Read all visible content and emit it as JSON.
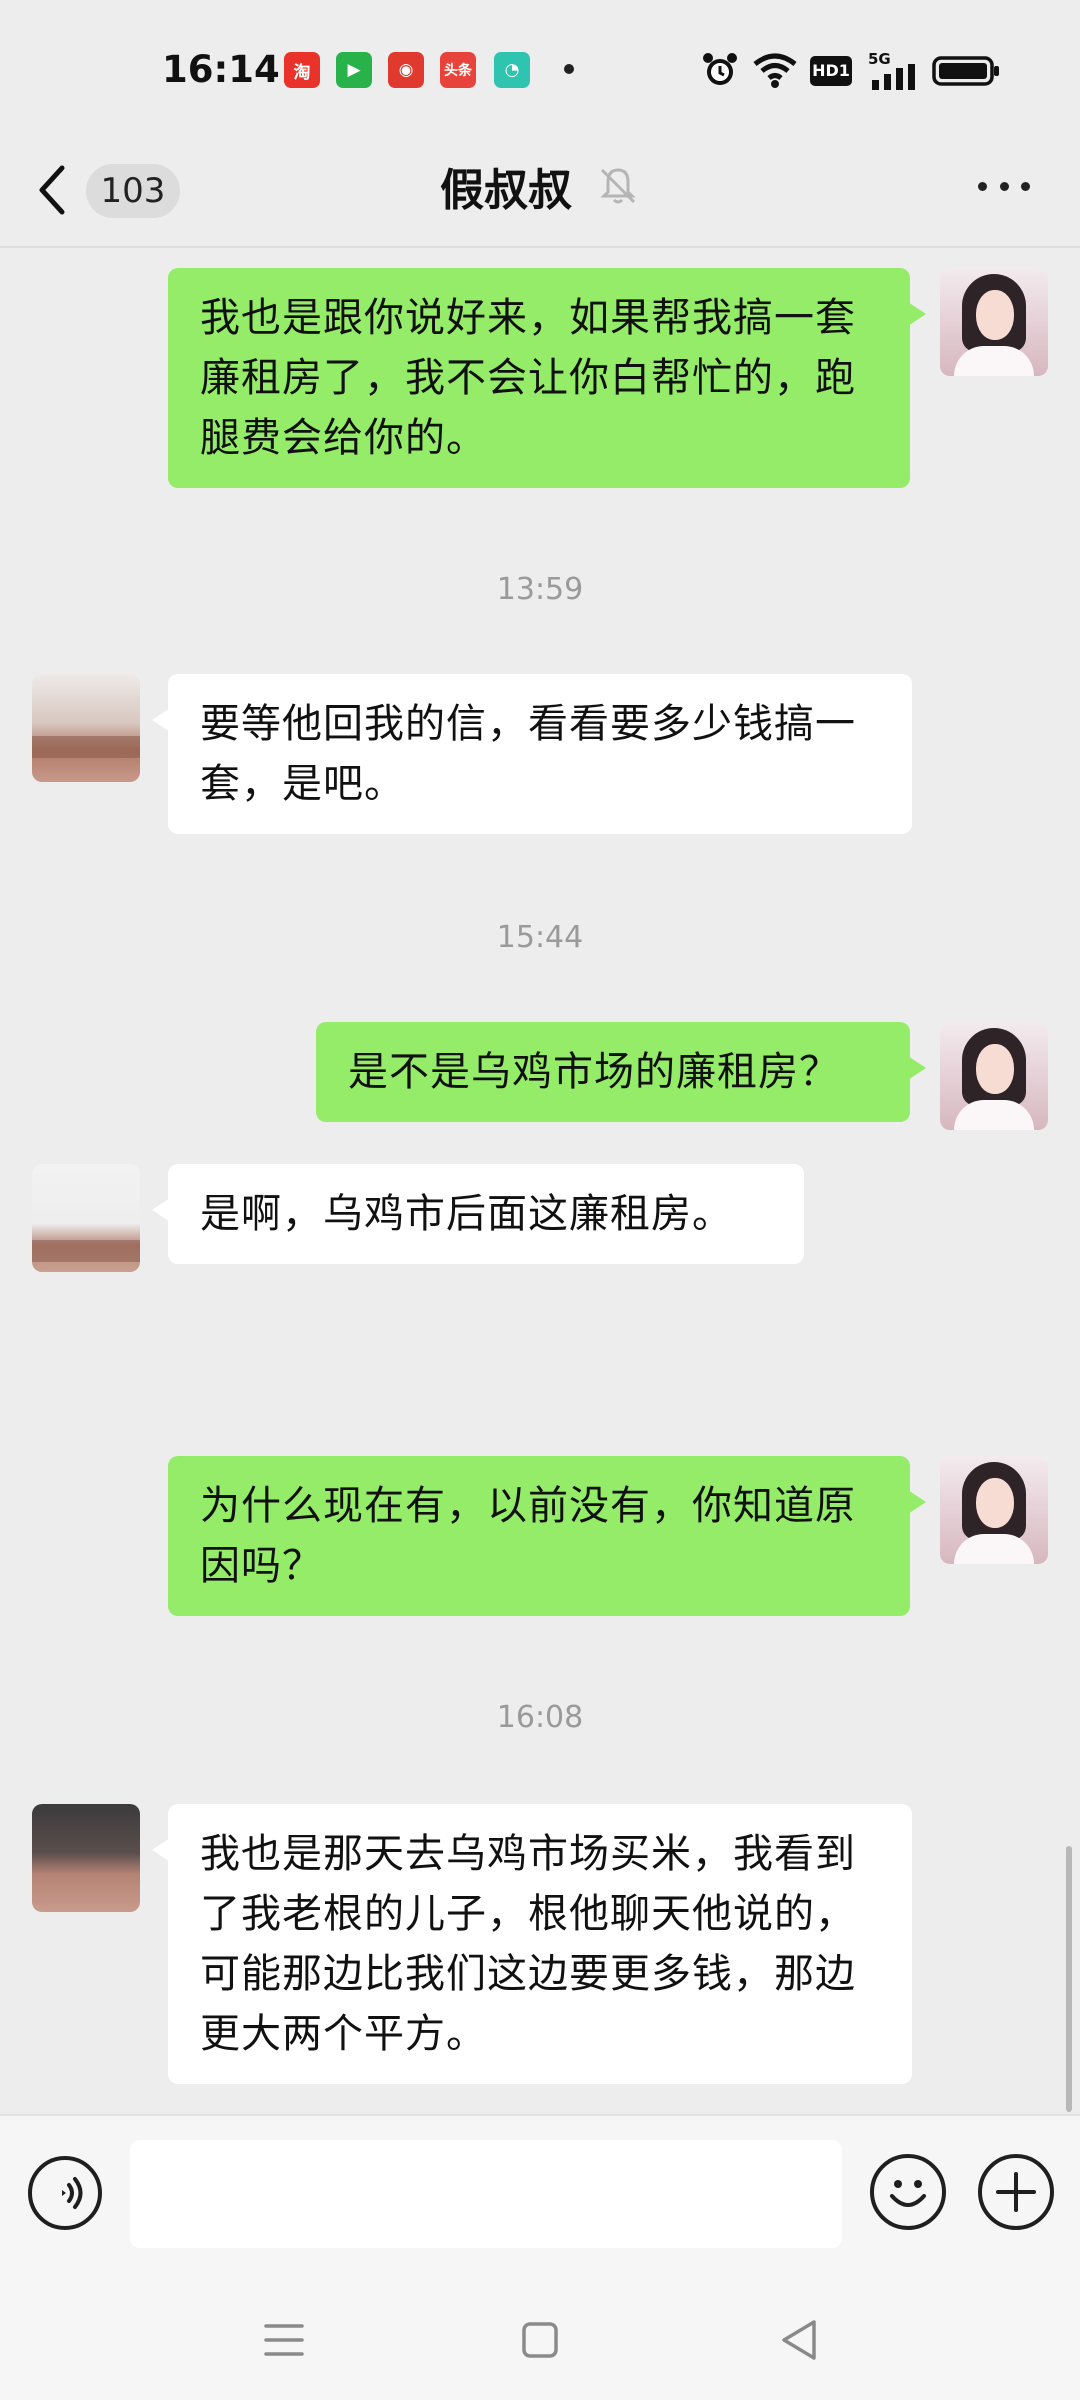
{
  "status_bar": {
    "time": "16:14",
    "apps": [
      {
        "icon": "taobao-app-icon",
        "label": "淘",
        "color": "#e8322a"
      },
      {
        "icon": "tencent-video-app-icon",
        "label": "▶",
        "color": "#27b24a"
      },
      {
        "icon": "news-app-icon",
        "label": "◉",
        "color": "#e03a2e"
      },
      {
        "icon": "toutiao-app-icon",
        "label": "头条",
        "color": "#e8433a"
      },
      {
        "icon": "chat-app-icon",
        "label": "◔",
        "color": "#2ec4b0"
      }
    ],
    "hd_label": "HD1",
    "network_label": "5G"
  },
  "header": {
    "unread_count": "103",
    "title": "假叔叔"
  },
  "messages": [
    {
      "side": "out",
      "text": "我也是跟你说好来，如果帮我搞一套廉租房了，我不会让你白帮忙的，跑腿费会给你的。"
    },
    {
      "type": "time",
      "text": "13:59"
    },
    {
      "side": "in",
      "text": "要等他回我的信，看看要多少钱搞一套，是吧。"
    },
    {
      "type": "time",
      "text": "15:44"
    },
    {
      "side": "out",
      "text": "是不是乌鸡市场的廉租房？"
    },
    {
      "side": "in",
      "text": "是啊，乌鸡市后面这廉租房。"
    },
    {
      "side": "out",
      "text": "为什么现在有，以前没有，你知道原因吗？"
    },
    {
      "type": "time",
      "text": "16:08"
    },
    {
      "side": "in",
      "text": "我也是那天去乌鸡市场买米，我看到了我老根的儿子，根他聊天他说的，可能那边比我们这边要更多钱，那边更大两个平方。"
    }
  ],
  "input": {
    "value": "",
    "placeholder": ""
  },
  "colors": {
    "outgoing_bubble": "#95ec69",
    "incoming_bubble": "#ffffff",
    "background": "#ededed"
  }
}
